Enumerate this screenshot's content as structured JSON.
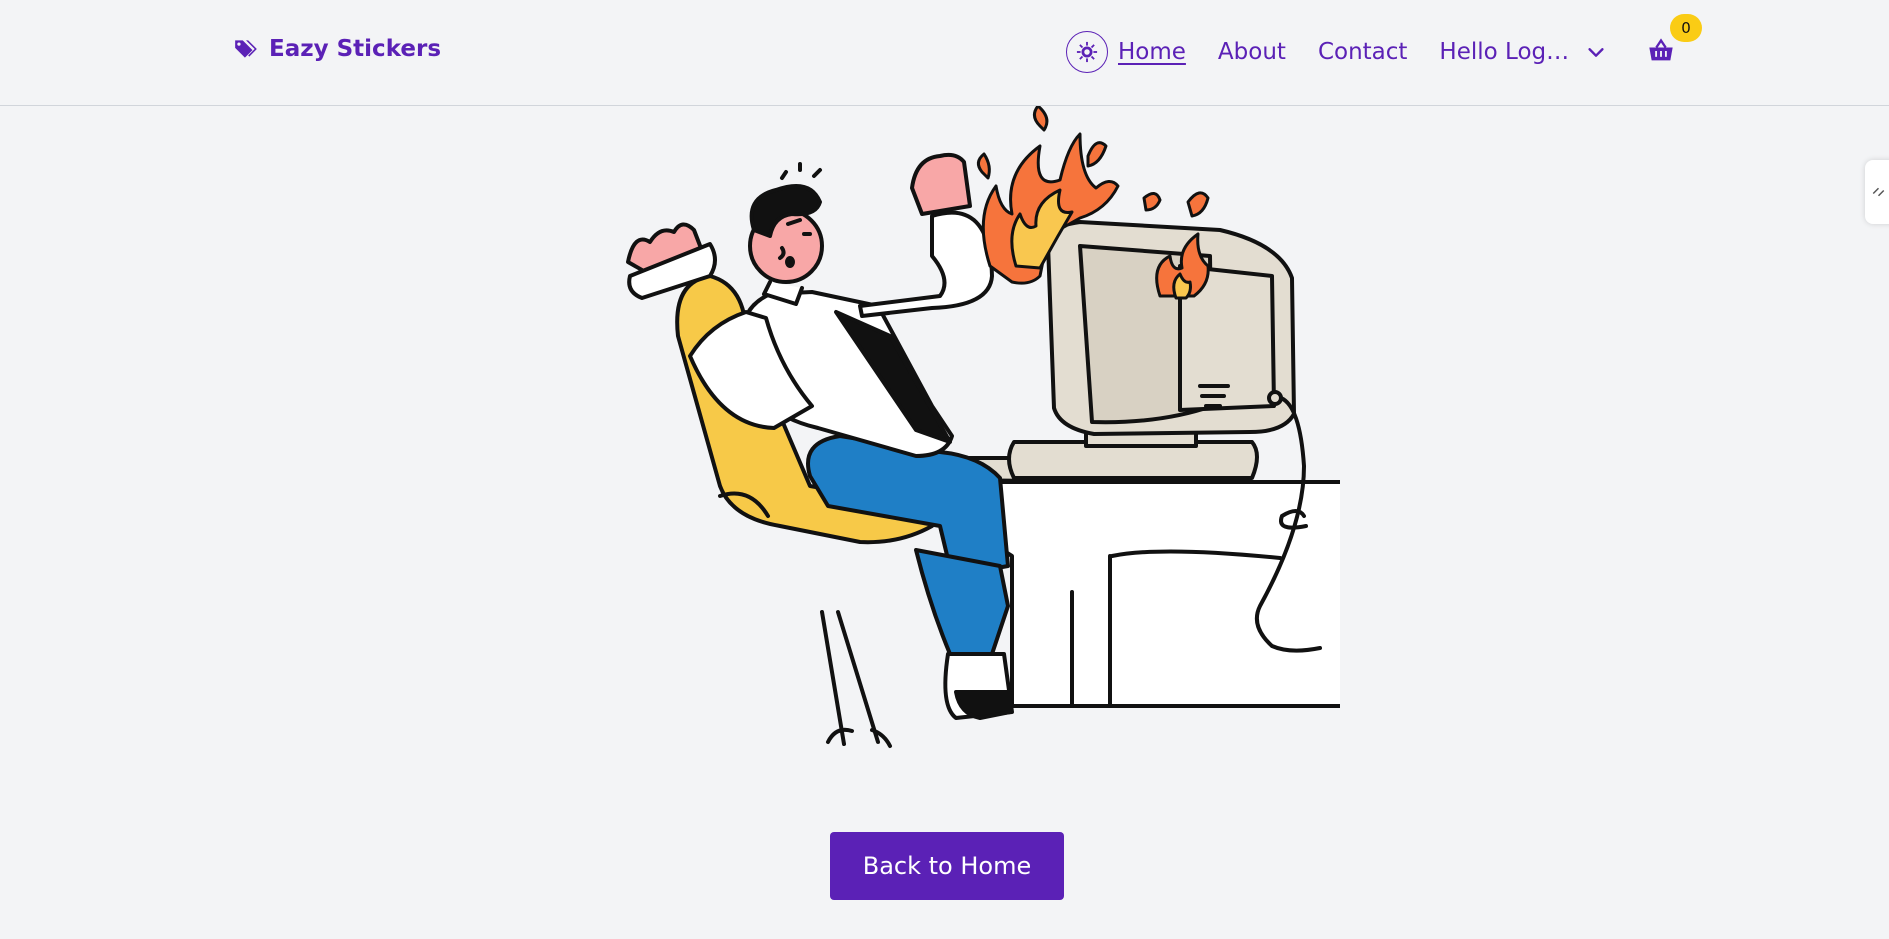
{
  "header": {
    "brand": "Eazy Stickers",
    "nav": [
      {
        "label": "Home",
        "active": true
      },
      {
        "label": "About",
        "active": false
      },
      {
        "label": "Contact",
        "active": false
      }
    ],
    "user_menu_label": "Hello Logeswaran",
    "cart_count": "0"
  },
  "main": {
    "back_button_label": "Back to Home"
  },
  "colors": {
    "brand_purple": "#5b21b6",
    "badge_yellow": "#facc15",
    "background": "#f3f4f6"
  },
  "icons": {
    "brand": "tags-icon",
    "theme": "sun-gear-icon",
    "dropdown": "chevron-down-icon",
    "cart": "shopping-basket-icon"
  }
}
